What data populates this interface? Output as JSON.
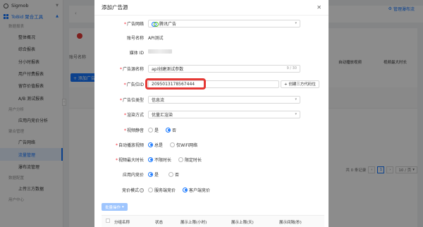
{
  "sidebar": {
    "brand": "Sigmob",
    "tool_group": "ToBid 聚合工具",
    "sections": [
      {
        "title": "数据报表",
        "items": [
          "整体概况",
          "综合报表",
          "分小时报表",
          "用户付费报表",
          "留存价值报表",
          "A/B 测试报表"
        ]
      },
      {
        "title": "用户分析",
        "items": [
          "应用内竞价分析"
        ]
      },
      {
        "title": "聚合管理",
        "items": [
          "广告网络",
          "流量管理",
          "瀑布流管理"
        ]
      },
      {
        "title": "数据配置",
        "items": [
          "上传三方数据"
        ]
      },
      {
        "title": "用户中心",
        "items": []
      }
    ],
    "active_item": "流量管理"
  },
  "background": {
    "manage_link": "管理瀑布流",
    "account_label": "账号名称",
    "add_button": "+ 添加广告源",
    "columns": [
      "自动播放视频",
      "视频最大时长"
    ],
    "pager": {
      "total": "共 0 条记录",
      "page": "1",
      "page_size": "10 / 页"
    }
  },
  "modal": {
    "title": "添加广告源",
    "fields": {
      "ad_network": {
        "label": "广告网络",
        "value": "腾讯广告"
      },
      "account_name": {
        "label": "账号名称",
        "value": "API测试"
      },
      "media_id": {
        "label": "媒体 ID",
        "value": ""
      },
      "source_name": {
        "label": "广告源名称",
        "value": "api创建测试参数",
        "counter": "9 / 30"
      },
      "ad_slot_id": {
        "label": "广告位ID",
        "value": "2095013178567444",
        "create_button": "+ 创建三方代码位"
      },
      "slot_type": {
        "label": "广告位类型",
        "value": "信息流"
      },
      "render_mode": {
        "label": "渲染方式",
        "value": "优量汇渲染"
      },
      "video_mute": {
        "label": "视频静音",
        "options": [
          "是",
          "否"
        ],
        "selected": "否"
      },
      "autoplay": {
        "label": "自动播放视频",
        "options": [
          "总是",
          "仅WiFi网络"
        ],
        "selected": "总是"
      },
      "max_duration": {
        "label": "视频最大时长",
        "options": [
          "不限时长",
          "限定时长"
        ],
        "selected": "不限时长"
      },
      "inapp_bidding": {
        "label": "应用内竞价",
        "options": [
          "是",
          "否"
        ],
        "selected": "是"
      },
      "bid_mode": {
        "label": "竞价模式",
        "options": [
          "服务端竞价",
          "客户端竞价"
        ],
        "selected": "客户端竞价"
      }
    },
    "batch_button": "批量操作",
    "sub_table": {
      "columns": [
        "分组名称",
        "状态",
        "展示上限(小时)",
        "展示上限(天)",
        "展示间隔(秒)"
      ]
    }
  },
  "colors": {
    "primary": "#1677ff",
    "highlight": "#e53935",
    "required": "#f5222d"
  }
}
